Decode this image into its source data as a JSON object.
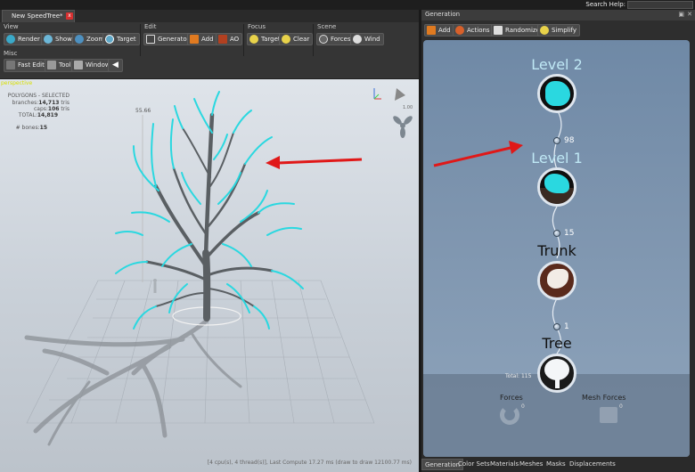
{
  "search": {
    "label": "Search Help:",
    "value": ""
  },
  "document_tab": {
    "title": "New SpeedTree*",
    "close": "x"
  },
  "toolbar": {
    "view": {
      "label": "View",
      "render": "Render",
      "show": "Show",
      "zoom": "Zoom",
      "target": "Target"
    },
    "edit": {
      "label": "Edit",
      "generators": "Generators",
      "add": "Add",
      "ao": "AO"
    },
    "focus": {
      "label": "Focus",
      "target": "Target",
      "clear": "Clear"
    },
    "scene": {
      "label": "Scene",
      "forces": "Forces",
      "wind": "Wind"
    },
    "misc": {
      "label": "Misc",
      "fast_edit": "Fast Edit",
      "tool": "Tool",
      "window": "Window"
    }
  },
  "viewport": {
    "label": "perspective",
    "stats": {
      "header": "POLYGONS - SELECTED",
      "branches_label": "branches:",
      "branches_value": "14,713",
      "branches_unit": "tris",
      "caps_label": "caps:",
      "caps_value": "106",
      "caps_unit": "tris",
      "total_label": "TOTAL:",
      "total_value": "14,819",
      "bones_label": "# bones:",
      "bones_value": "15"
    },
    "height_marker": "55.66",
    "gizmo_value": "1.00",
    "status": "[4 cpu(s), 4 thread(s)], Last Compute 17.27 ms (draw to draw 12100.77 ms)"
  },
  "generation": {
    "title": "Generation",
    "toolbar": {
      "add": "Add",
      "actions": "Actions",
      "randomize": "Randomize",
      "simplify": "Simplify"
    },
    "nodes": [
      {
        "label": "Level 2",
        "color": "#bfe8f5"
      },
      {
        "label": "Level 1",
        "color": "#bfe8f5"
      },
      {
        "label": "Trunk",
        "color": "#111111"
      },
      {
        "label": "Tree",
        "color": "#111111"
      }
    ],
    "counts": [
      "98",
      "15",
      "1"
    ],
    "total": "Total: 115",
    "forces": {
      "label": "Forces",
      "count": "0"
    },
    "mesh_forces": {
      "label": "Mesh Forces",
      "count": "0"
    }
  },
  "bottom_tabs": [
    "Generation",
    "Color Sets",
    "Materials",
    "Meshes",
    "Masks",
    "Displacements"
  ],
  "colors": {
    "accent_cyan": "#2ad8e0",
    "arrow_red": "#e01818",
    "branch_gray": "#5a5f63"
  }
}
